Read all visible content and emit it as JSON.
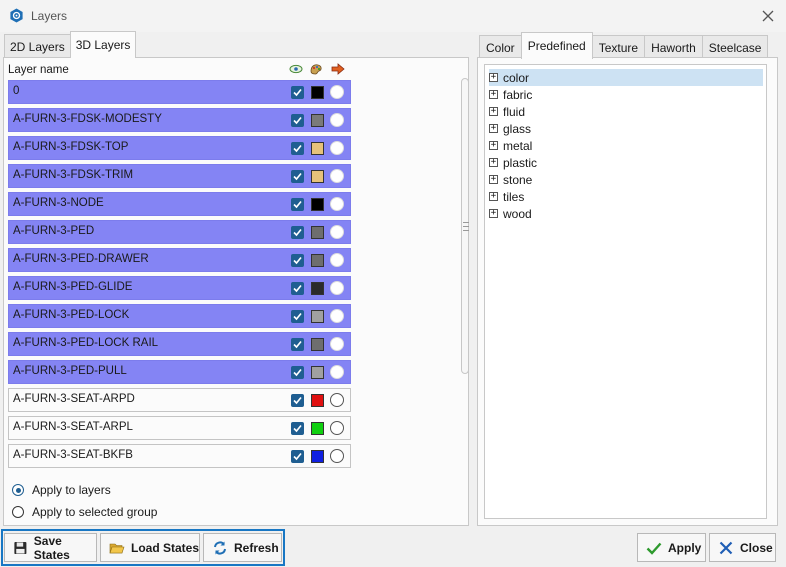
{
  "window": {
    "title": "Layers"
  },
  "left_tabs": [
    "2D Layers",
    "3D Layers"
  ],
  "layer_list": {
    "column_header": "Layer name",
    "header_icons": [
      "eye-icon",
      "palette-icon",
      "arrow-icon"
    ],
    "rows": [
      {
        "name": "0",
        "selected": true,
        "swatch": "#000000",
        "checked": true
      },
      {
        "name": "A-FURN-3-FDSK-MODESTY",
        "selected": true,
        "swatch": "#7a7a7a",
        "checked": true
      },
      {
        "name": "A-FURN-3-FDSK-TOP",
        "selected": true,
        "swatch": "#e6c27a",
        "checked": true
      },
      {
        "name": "A-FURN-3-FDSK-TRIM",
        "selected": true,
        "swatch": "#e6c27a",
        "checked": true
      },
      {
        "name": "A-FURN-3-NODE",
        "selected": true,
        "swatch": "#000000",
        "checked": true
      },
      {
        "name": "A-FURN-3-PED",
        "selected": true,
        "swatch": "#6e6e6e",
        "checked": true
      },
      {
        "name": "A-FURN-3-PED-DRAWER",
        "selected": true,
        "swatch": "#6e6e6e",
        "checked": true
      },
      {
        "name": "A-FURN-3-PED-GLIDE",
        "selected": true,
        "swatch": "#2b2b2b",
        "checked": true
      },
      {
        "name": "A-FURN-3-PED-LOCK",
        "selected": true,
        "swatch": "#a0a0a0",
        "checked": true
      },
      {
        "name": "A-FURN-3-PED-LOCK RAIL",
        "selected": true,
        "swatch": "#6e6e6e",
        "checked": true
      },
      {
        "name": "A-FURN-3-PED-PULL",
        "selected": true,
        "swatch": "#a0a0a0",
        "checked": true
      },
      {
        "name": "A-FURN-3-SEAT-ARPD",
        "selected": false,
        "swatch": "#e01010",
        "checked": true
      },
      {
        "name": "A-FURN-3-SEAT-ARPL",
        "selected": false,
        "swatch": "#10d010",
        "checked": true
      },
      {
        "name": "A-FURN-3-SEAT-BKFB",
        "selected": false,
        "swatch": "#1020e0",
        "checked": true
      }
    ]
  },
  "apply_options": {
    "selected": "layers",
    "layers_label": "Apply to layers",
    "group_label": "Apply to selected group"
  },
  "right_tabs": [
    "Color",
    "Predefined",
    "Texture",
    "Haworth",
    "Steelcase"
  ],
  "active_right_tab": "Predefined",
  "tree": [
    {
      "label": "color",
      "selected": true
    },
    {
      "label": "fabric",
      "selected": false
    },
    {
      "label": "fluid",
      "selected": false
    },
    {
      "label": "glass",
      "selected": false
    },
    {
      "label": "metal",
      "selected": false
    },
    {
      "label": "plastic",
      "selected": false
    },
    {
      "label": "stone",
      "selected": false
    },
    {
      "label": "tiles",
      "selected": false
    },
    {
      "label": "wood",
      "selected": false
    }
  ],
  "buttons": {
    "save_states": "Save States",
    "load_states": "Load States",
    "refresh": "Refresh",
    "apply": "Apply",
    "close": "Close"
  },
  "colors": {
    "selected_row": "#8484f4",
    "checkbox": "#1f5e91",
    "highlight_border": "#1877c4"
  }
}
